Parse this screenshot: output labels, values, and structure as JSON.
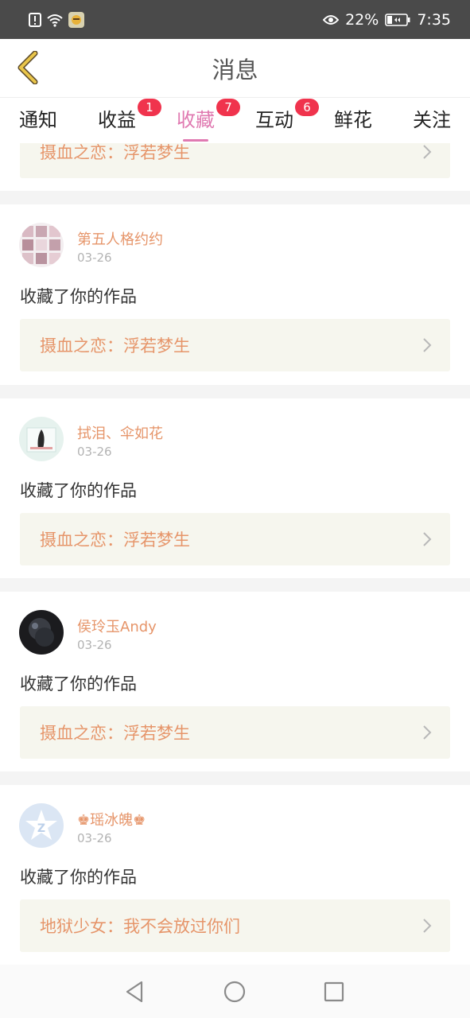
{
  "status": {
    "battery": "22%",
    "time": "7:35"
  },
  "header": {
    "title": "消息"
  },
  "tabs": [
    {
      "label": "通知",
      "badge": ""
    },
    {
      "label": "收益",
      "badge": "1"
    },
    {
      "label": "收藏",
      "badge": "7",
      "active": true
    },
    {
      "label": "互动",
      "badge": "6"
    },
    {
      "label": "鲜花",
      "badge": ""
    },
    {
      "label": "关注",
      "badge": ""
    }
  ],
  "partial_card": {
    "work": "摄血之恋：浮若梦生"
  },
  "items": [
    {
      "user": "第五人格约约",
      "date": "03-26",
      "action": "收藏了你的作品",
      "work": "摄血之恋：浮若梦生"
    },
    {
      "user": "拭泪、伞如花",
      "date": "03-26",
      "action": "收藏了你的作品",
      "work": "摄血之恋：浮若梦生"
    },
    {
      "user": "侯玲玉Andy",
      "date": "03-26",
      "action": "收藏了你的作品",
      "work": "摄血之恋：浮若梦生"
    },
    {
      "user": "♚瑶冰魄♚",
      "date": "03-26",
      "action": "收藏了你的作品",
      "work": "地狱少女：我不会放过你们"
    }
  ],
  "colors": {
    "accent": "#e07ab1",
    "badge": "#f0334d",
    "username": "#e6956a"
  }
}
